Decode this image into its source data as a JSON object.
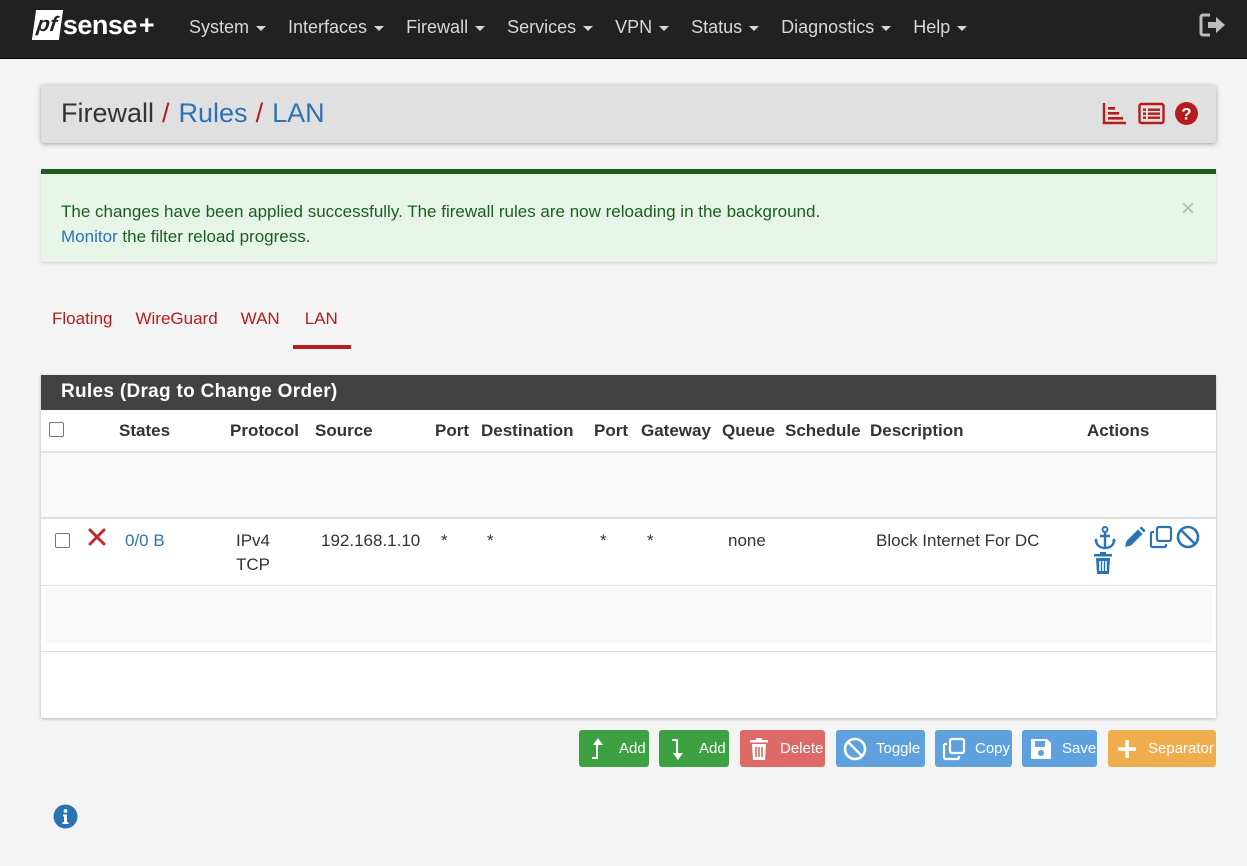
{
  "brand": {
    "pf": "pf",
    "sense": "sense",
    "plus": "+"
  },
  "nav": {
    "items": [
      {
        "label": "System"
      },
      {
        "label": "Interfaces"
      },
      {
        "label": "Firewall"
      },
      {
        "label": "Services"
      },
      {
        "label": "VPN"
      },
      {
        "label": "Status"
      },
      {
        "label": "Diagnostics"
      },
      {
        "label": "Help"
      }
    ],
    "logout_icon": "sign-out-icon"
  },
  "breadcrumb": {
    "items": [
      "Firewall",
      "Rules",
      "LAN"
    ],
    "separator": "/",
    "icons": [
      "bar-chart-icon",
      "list-alt-icon",
      "question-circle-icon"
    ]
  },
  "alert": {
    "line1": "The changes have been applied successfully. The firewall rules are now reloading in the background.",
    "monitor_link": "Monitor",
    "line2_rest": " the filter reload progress.",
    "close": "×"
  },
  "tabs": [
    {
      "label": "Floating",
      "active": false
    },
    {
      "label": "WireGuard",
      "active": false
    },
    {
      "label": "WAN",
      "active": false
    },
    {
      "label": "LAN",
      "active": true
    }
  ],
  "rules_panel": {
    "title": "Rules (Drag to Change Order)",
    "columns": [
      "States",
      "Protocol",
      "Source",
      "Port",
      "Destination",
      "Port",
      "Gateway",
      "Queue",
      "Schedule",
      "Description",
      "Actions"
    ],
    "rows": [
      {
        "action_icon": "times-icon",
        "states": "0/0 B",
        "protocol_line1": "IPv4",
        "protocol_line2": "TCP",
        "source": "192.168.1.10",
        "source_port": "*",
        "destination": "*",
        "destination_port": "*",
        "gateway": "*",
        "queue": "none",
        "schedule": "",
        "description": "Block Internet For DC",
        "actions": [
          "anchor-icon",
          "pencil-icon",
          "clone-icon",
          "ban-icon",
          "trash-icon"
        ]
      }
    ]
  },
  "buttons": {
    "add_top": "Add",
    "add_bottom": "Add",
    "delete": "Delete",
    "toggle": "Toggle",
    "copy": "Copy",
    "save": "Save",
    "separator": "Separator"
  },
  "colors": {
    "navbar": "#212121",
    "accent_red": "#b71c1c",
    "link_blue": "#2c73b5",
    "success_green": "#1b5e20",
    "btn_green": "#3da041",
    "btn_red": "#dd6a66",
    "btn_blue": "#5fa1de",
    "btn_orange": "#f0ad4e"
  }
}
